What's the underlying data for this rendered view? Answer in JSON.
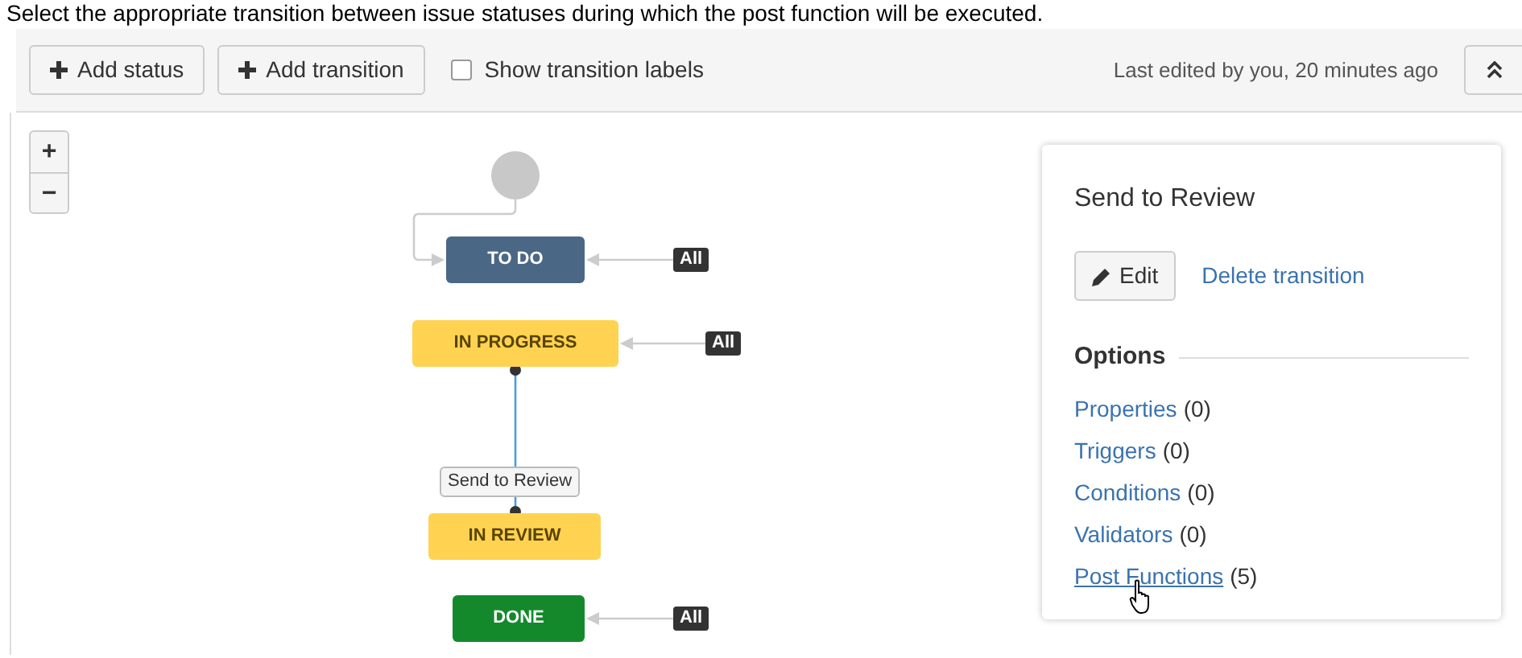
{
  "instruction": "Select the appropriate transition between issue statuses during which the post function will be executed.",
  "toolbar": {
    "buttons": [
      {
        "label": "Add status"
      },
      {
        "label": "Add transition"
      }
    ],
    "show_labels": {
      "label": "Show transition labels",
      "checked": false
    },
    "last_edited": "Last edited by you, 20 minutes ago"
  },
  "zoom_controls": [
    "+",
    "−"
  ],
  "statuses": [
    {
      "name": "TO DO",
      "kind": "todo",
      "global_label": "All",
      "initial": true
    },
    {
      "name": "IN PROGRESS",
      "kind": "inprogress",
      "global_label": "All"
    },
    {
      "name": "IN REVIEW",
      "kind": "inprogress"
    },
    {
      "name": "DONE",
      "kind": "done",
      "global_label": "All"
    }
  ],
  "transition": {
    "label": "Send to Review",
    "selected": true
  },
  "panel": {
    "title": "Send to Review",
    "edit_button": "Edit",
    "delete_link": "Delete transition",
    "options_heading": "Options",
    "options": [
      {
        "label": "Properties",
        "count": "(0)",
        "hovered": false
      },
      {
        "label": "Triggers",
        "count": "(0)",
        "hovered": false
      },
      {
        "label": "Conditions",
        "count": "(0)",
        "hovered": false
      },
      {
        "label": "Validators",
        "count": "(0)",
        "hovered": false
      },
      {
        "label": "Post Functions",
        "count": "(5)",
        "hovered": true
      }
    ]
  }
}
